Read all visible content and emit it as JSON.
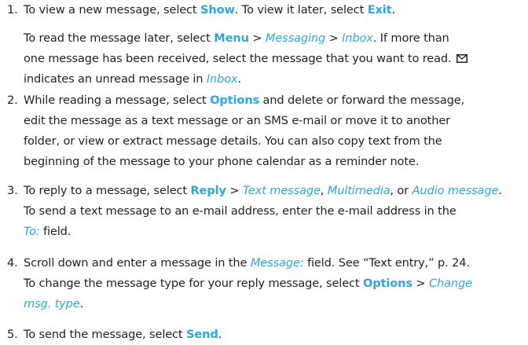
{
  "steps": [
    {
      "number": "1.",
      "lines": [
        [
          {
            "t": "To view a new message, select "
          },
          {
            "t": "Show",
            "s": "ui"
          },
          {
            "t": ". To view it later, select "
          },
          {
            "t": "Exit",
            "s": "ui"
          },
          {
            "t": "."
          }
        ]
      ],
      "para2_lines": [
        [
          {
            "t": "To read the message later, select "
          },
          {
            "t": "Menu",
            "s": "ui"
          },
          {
            "t": " > "
          },
          {
            "t": "Messaging",
            "s": "it"
          },
          {
            "t": " > "
          },
          {
            "t": "Inbox",
            "s": "it"
          },
          {
            "t": ". If more than"
          }
        ],
        [
          {
            "t": "one message has been received, select the message that you want to read. "
          },
          {
            "icon": "envelope-icon"
          }
        ],
        [
          {
            "t": "indicates an unread message in "
          },
          {
            "t": "Inbox",
            "s": "it"
          },
          {
            "t": "."
          }
        ]
      ]
    },
    {
      "number": "2.",
      "lines": [
        [
          {
            "t": "While reading a message, select "
          },
          {
            "t": "Options",
            "s": "ui"
          },
          {
            "t": " and delete or forward the message,"
          }
        ],
        [
          {
            "t": "edit the message as a text message or an SMS e-mail or move it to another"
          }
        ],
        [
          {
            "t": "folder, or view or extract message details. You can also copy text from the"
          }
        ],
        [
          {
            "t": "beginning of the message to your phone calendar as a reminder note."
          }
        ]
      ]
    },
    {
      "number": "3.",
      "lines": [
        [
          {
            "t": "To reply to a message, select "
          },
          {
            "t": "Reply",
            "s": "ui"
          },
          {
            "t": " > "
          },
          {
            "t": "Text message",
            "s": "it"
          },
          {
            "t": ", "
          },
          {
            "t": "Multimedia",
            "s": "it"
          },
          {
            "t": ", or "
          },
          {
            "t": "Audio message",
            "s": "it"
          },
          {
            "t": "."
          }
        ],
        [
          {
            "t": "To send a text message to an e-mail address, enter the e-mail address in the"
          }
        ],
        [
          {
            "t": "To:",
            "s": "it"
          },
          {
            "t": " field."
          }
        ]
      ]
    },
    {
      "number": "4.",
      "lines": [
        [
          {
            "t": "Scroll down and enter a message in the "
          },
          {
            "t": "Message:",
            "s": "it"
          },
          {
            "t": " field. See “Text entry,” p. 24."
          }
        ],
        [
          {
            "t": "To change the message type for your reply message, select "
          },
          {
            "t": "Options",
            "s": "ui"
          },
          {
            "t": " > "
          },
          {
            "t": "Change",
            "s": "it"
          }
        ],
        [
          {
            "t": "msg. type",
            "s": "it"
          },
          {
            "t": "."
          }
        ]
      ]
    },
    {
      "number": "5.",
      "lines": [
        [
          {
            "t": "To send the message, select "
          },
          {
            "t": "Send",
            "s": "ui"
          },
          {
            "t": "."
          }
        ]
      ]
    }
  ],
  "colors": {
    "text": "#231f20",
    "accent": "#2ea7e0"
  }
}
